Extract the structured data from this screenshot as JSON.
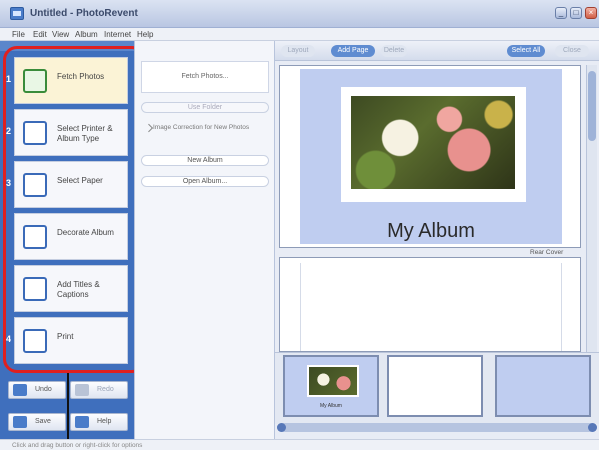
{
  "window": {
    "title": "Untitled - PhotoRevent",
    "minimize_icon": "minimize-icon",
    "maximize_icon": "maximize-icon",
    "close_icon": "close-icon"
  },
  "menu": [
    "File",
    "Edit",
    "View",
    "Album",
    "Internet",
    "Help"
  ],
  "steps": [
    {
      "number": "1",
      "label": "Fetch Photos",
      "icon": "fetch-photos-icon",
      "active": true
    },
    {
      "number": "2",
      "label": "Select Printer & Album Type",
      "icon": "printer-album-icon",
      "active": false
    },
    {
      "number": "3",
      "label": "Select Paper",
      "icon": "paper-icon",
      "active": false
    },
    {
      "number": "",
      "label": "Decorate Album",
      "icon": "decorate-icon",
      "active": false
    },
    {
      "number": "",
      "label": "Add Titles & Captions",
      "icon": "titles-captions-icon",
      "active": false
    },
    {
      "number": "4",
      "label": "Print",
      "icon": "print-icon",
      "active": false
    }
  ],
  "bottom_buttons": [
    {
      "label": "Undo",
      "icon": "undo-icon",
      "disabled": false
    },
    {
      "label": "Redo",
      "icon": "redo-icon",
      "disabled": true
    },
    {
      "label": "Save",
      "icon": "save-icon",
      "disabled": false
    },
    {
      "label": "Help",
      "icon": "help-icon",
      "disabled": false
    }
  ],
  "middle": {
    "fetch_box": "Fetch Photos...",
    "use_folder": "Use Folder",
    "note": "Image Correction for New Photos",
    "new_album": "New Album",
    "open_album": "Open Album..."
  },
  "toolbar": {
    "left_disabled": "Layout",
    "add_page": "Add Page",
    "right_disabled": "Delete",
    "select_all": "Select All",
    "far_right": "Close"
  },
  "album": {
    "title": "My Album",
    "page_label": "Rear Cover",
    "thumb_label": "My Album"
  },
  "status": "Click and drag button or right-click for options"
}
